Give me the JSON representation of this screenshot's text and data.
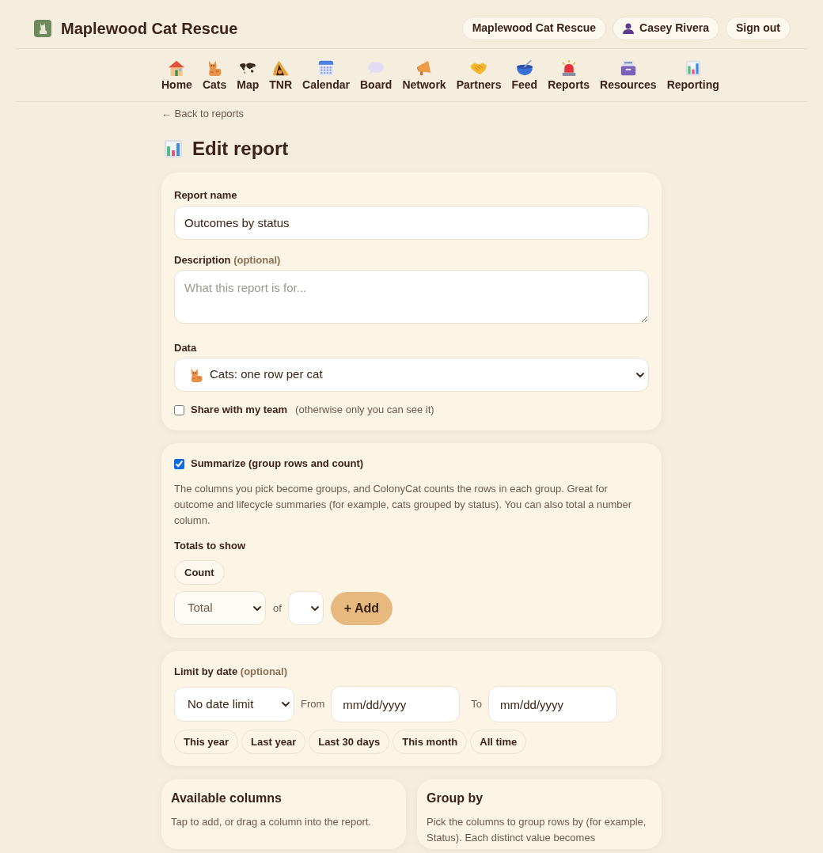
{
  "header": {
    "title": "Maplewood Cat Rescue",
    "org_button": "Maplewood Cat Rescue",
    "user_button": "Casey Rivera",
    "sign_out": "Sign out"
  },
  "nav": [
    {
      "label": "Home",
      "kind": "house"
    },
    {
      "label": "Cats",
      "kind": "cat"
    },
    {
      "label": "Map",
      "kind": "map"
    },
    {
      "label": "TNR",
      "kind": "tent"
    },
    {
      "label": "Calendar",
      "kind": "calendar"
    },
    {
      "label": "Board",
      "kind": "bubble"
    },
    {
      "label": "Network",
      "kind": "megaphone"
    },
    {
      "label": "Partners",
      "kind": "handshake"
    },
    {
      "label": "Feed",
      "kind": "bowl"
    },
    {
      "label": "Reports",
      "kind": "siren"
    },
    {
      "label": "Resources",
      "kind": "filebox"
    },
    {
      "label": "Reporting",
      "kind": "chart"
    }
  ],
  "back_link": "← Back to reports",
  "page_title": "Edit report",
  "details": {
    "name_label": "Report name",
    "name_value": "Outcomes by status",
    "description_label": "Description",
    "description_optional": "(optional)",
    "description_placeholder": "What this report is for...",
    "data_label": "Data",
    "data_value": "Cats: one row per cat",
    "share": {
      "label": "Share with my team",
      "hint": "(otherwise only you can see it)",
      "checked": false
    }
  },
  "summary": {
    "summarize": {
      "label": "Summarize (group rows and count)",
      "checked": true
    },
    "explanation": "The columns you pick become groups, and ColonyCat counts the rows in each group. Great for outcome and lifecycle summaries (for example, cats grouped by status). You can also total a number column.",
    "totals_label": "Totals to show",
    "totals": [
      "Count"
    ],
    "aggregate_select": "Total",
    "of_label": "of",
    "add_button": "+ Add"
  },
  "date_limit": {
    "label": "Limit by date",
    "optional": "(optional)",
    "range_select": "No date limit",
    "from_label": "From",
    "from_placeholder": "mm/dd/yyyy",
    "to_label": "To",
    "to_placeholder": "mm/dd/yyyy",
    "presets": [
      "This year",
      "Last year",
      "Last 30 days",
      "This month",
      "All time"
    ]
  },
  "panels": [
    {
      "title": "Available columns",
      "description": "Tap to add, or drag a column into the report."
    },
    {
      "title": "Group by",
      "description": "Pick the columns to group rows by (for example, Status). Each distinct value becomes"
    }
  ]
}
